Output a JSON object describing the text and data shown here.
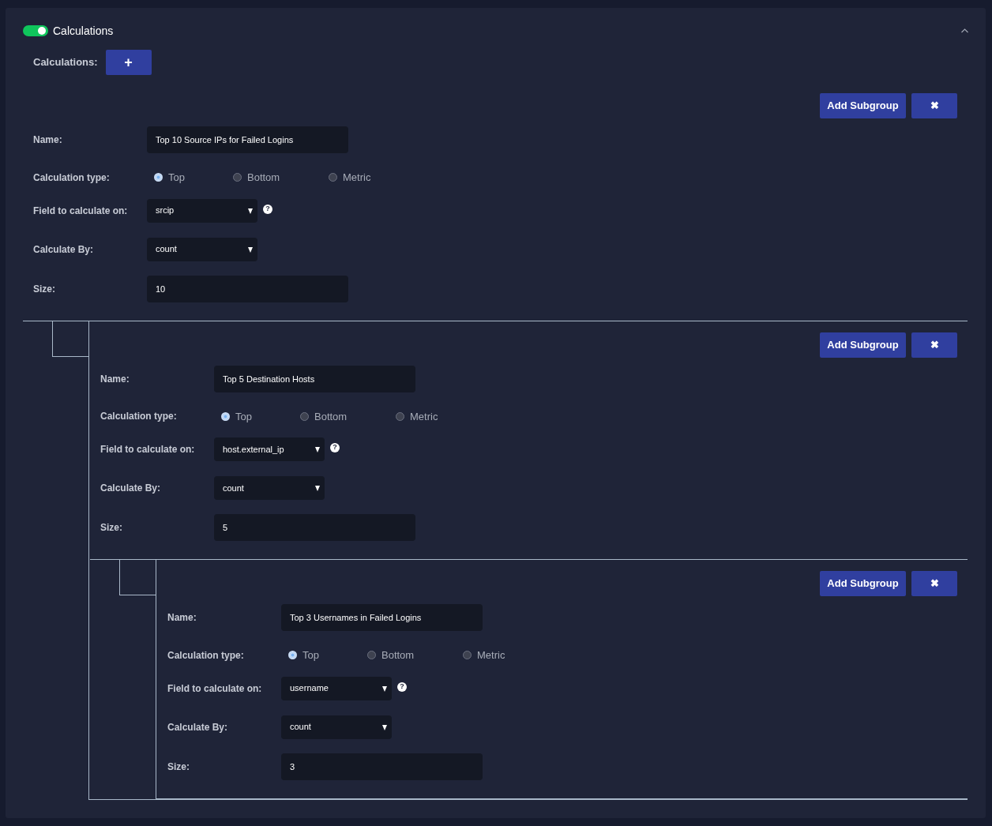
{
  "section": {
    "title": "Calculations",
    "enabled": true,
    "expanded": true
  },
  "add_label": "Calculations:",
  "add_button": "+",
  "groups": [
    {
      "add_subgroup": "Add Subgroup",
      "remove": "✖",
      "name_label": "Name:",
      "name": "Top 10 Source IPs for Failed Logins",
      "type_label": "Calculation type:",
      "types": [
        {
          "label": "Top",
          "selected": true
        },
        {
          "label": "Bottom",
          "selected": false
        },
        {
          "label": "Metric",
          "selected": false
        }
      ],
      "field_label": "Field to calculate on:",
      "field": "srcip",
      "help": "?",
      "calc_by_label": "Calculate By:",
      "calc_by": "count",
      "size_label": "Size:",
      "size": "10",
      "children": [
        {
          "add_subgroup": "Add Subgroup",
          "remove": "✖",
          "name_label": "Name:",
          "name": "Top 5 Destination Hosts",
          "type_label": "Calculation type:",
          "types": [
            {
              "label": "Top",
              "selected": true
            },
            {
              "label": "Bottom",
              "selected": false
            },
            {
              "label": "Metric",
              "selected": false
            }
          ],
          "field_label": "Field to calculate on:",
          "field": "host.external_ip",
          "help": "?",
          "calc_by_label": "Calculate By:",
          "calc_by": "count",
          "size_label": "Size:",
          "size": "5",
          "children": [
            {
              "add_subgroup": "Add Subgroup",
              "remove": "✖",
              "name_label": "Name:",
              "name": "Top 3 Usernames in Failed Logins",
              "type_label": "Calculation type:",
              "types": [
                {
                  "label": "Top",
                  "selected": true
                },
                {
                  "label": "Bottom",
                  "selected": false
                },
                {
                  "label": "Metric",
                  "selected": false
                }
              ],
              "field_label": "Field to calculate on:",
              "field": "username",
              "help": "?",
              "calc_by_label": "Calculate By:",
              "calc_by": "count",
              "size_label": "Size:",
              "size": "3"
            }
          ]
        }
      ]
    }
  ]
}
